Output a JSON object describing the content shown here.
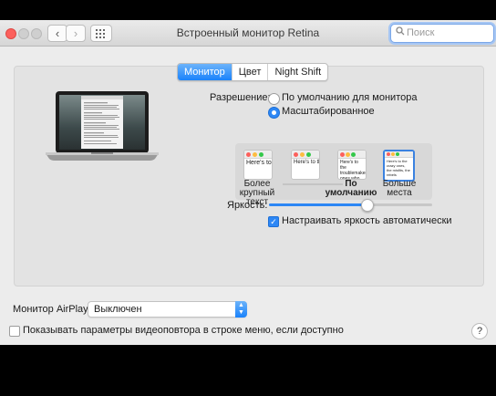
{
  "window": {
    "title": "Встроенный монитор Retina",
    "search_placeholder": "Поиск"
  },
  "tabs": [
    "Монитор",
    "Цвет",
    "Night Shift"
  ],
  "active_tab": "Монитор",
  "resolution": {
    "label": "Разрешение:",
    "options": [
      "По умолчанию для монитора",
      "Масштабированное"
    ],
    "selected": "Масштабированное"
  },
  "scaled_options": [
    {
      "preview_text": "Here's to the crazy ones, the troublemakers",
      "label_line1": "Более",
      "label_line2": "крупный текст",
      "bold": false
    },
    {
      "preview_text": "Here's to the troublemakers, ones who see",
      "label_line1": "",
      "label_line2": "",
      "bold": false
    },
    {
      "preview_text": "Here's to the troublemakers ones who see. And they",
      "label_line1": "По",
      "label_line2": "умолчанию",
      "bold": true
    },
    {
      "preview_text": "Here's to the crazy ones, the misfits, the rebels",
      "label_line1": "Больше",
      "label_line2": "места",
      "bold": false
    }
  ],
  "scaled_selected_index": 3,
  "brightness": {
    "label": "Яркость:",
    "level": 0.6,
    "auto_label": "Настраивать яркость автоматически",
    "auto_checked": true
  },
  "airplay": {
    "label": "Монитор AirPlay:",
    "value": "Выключен"
  },
  "mirroring": {
    "label": "Показывать параметры видеоповтора в строке меню, если доступно",
    "checked": false
  },
  "help_label": "?",
  "colors": {
    "accent": "#2d87f5",
    "close": "#fc605c"
  }
}
